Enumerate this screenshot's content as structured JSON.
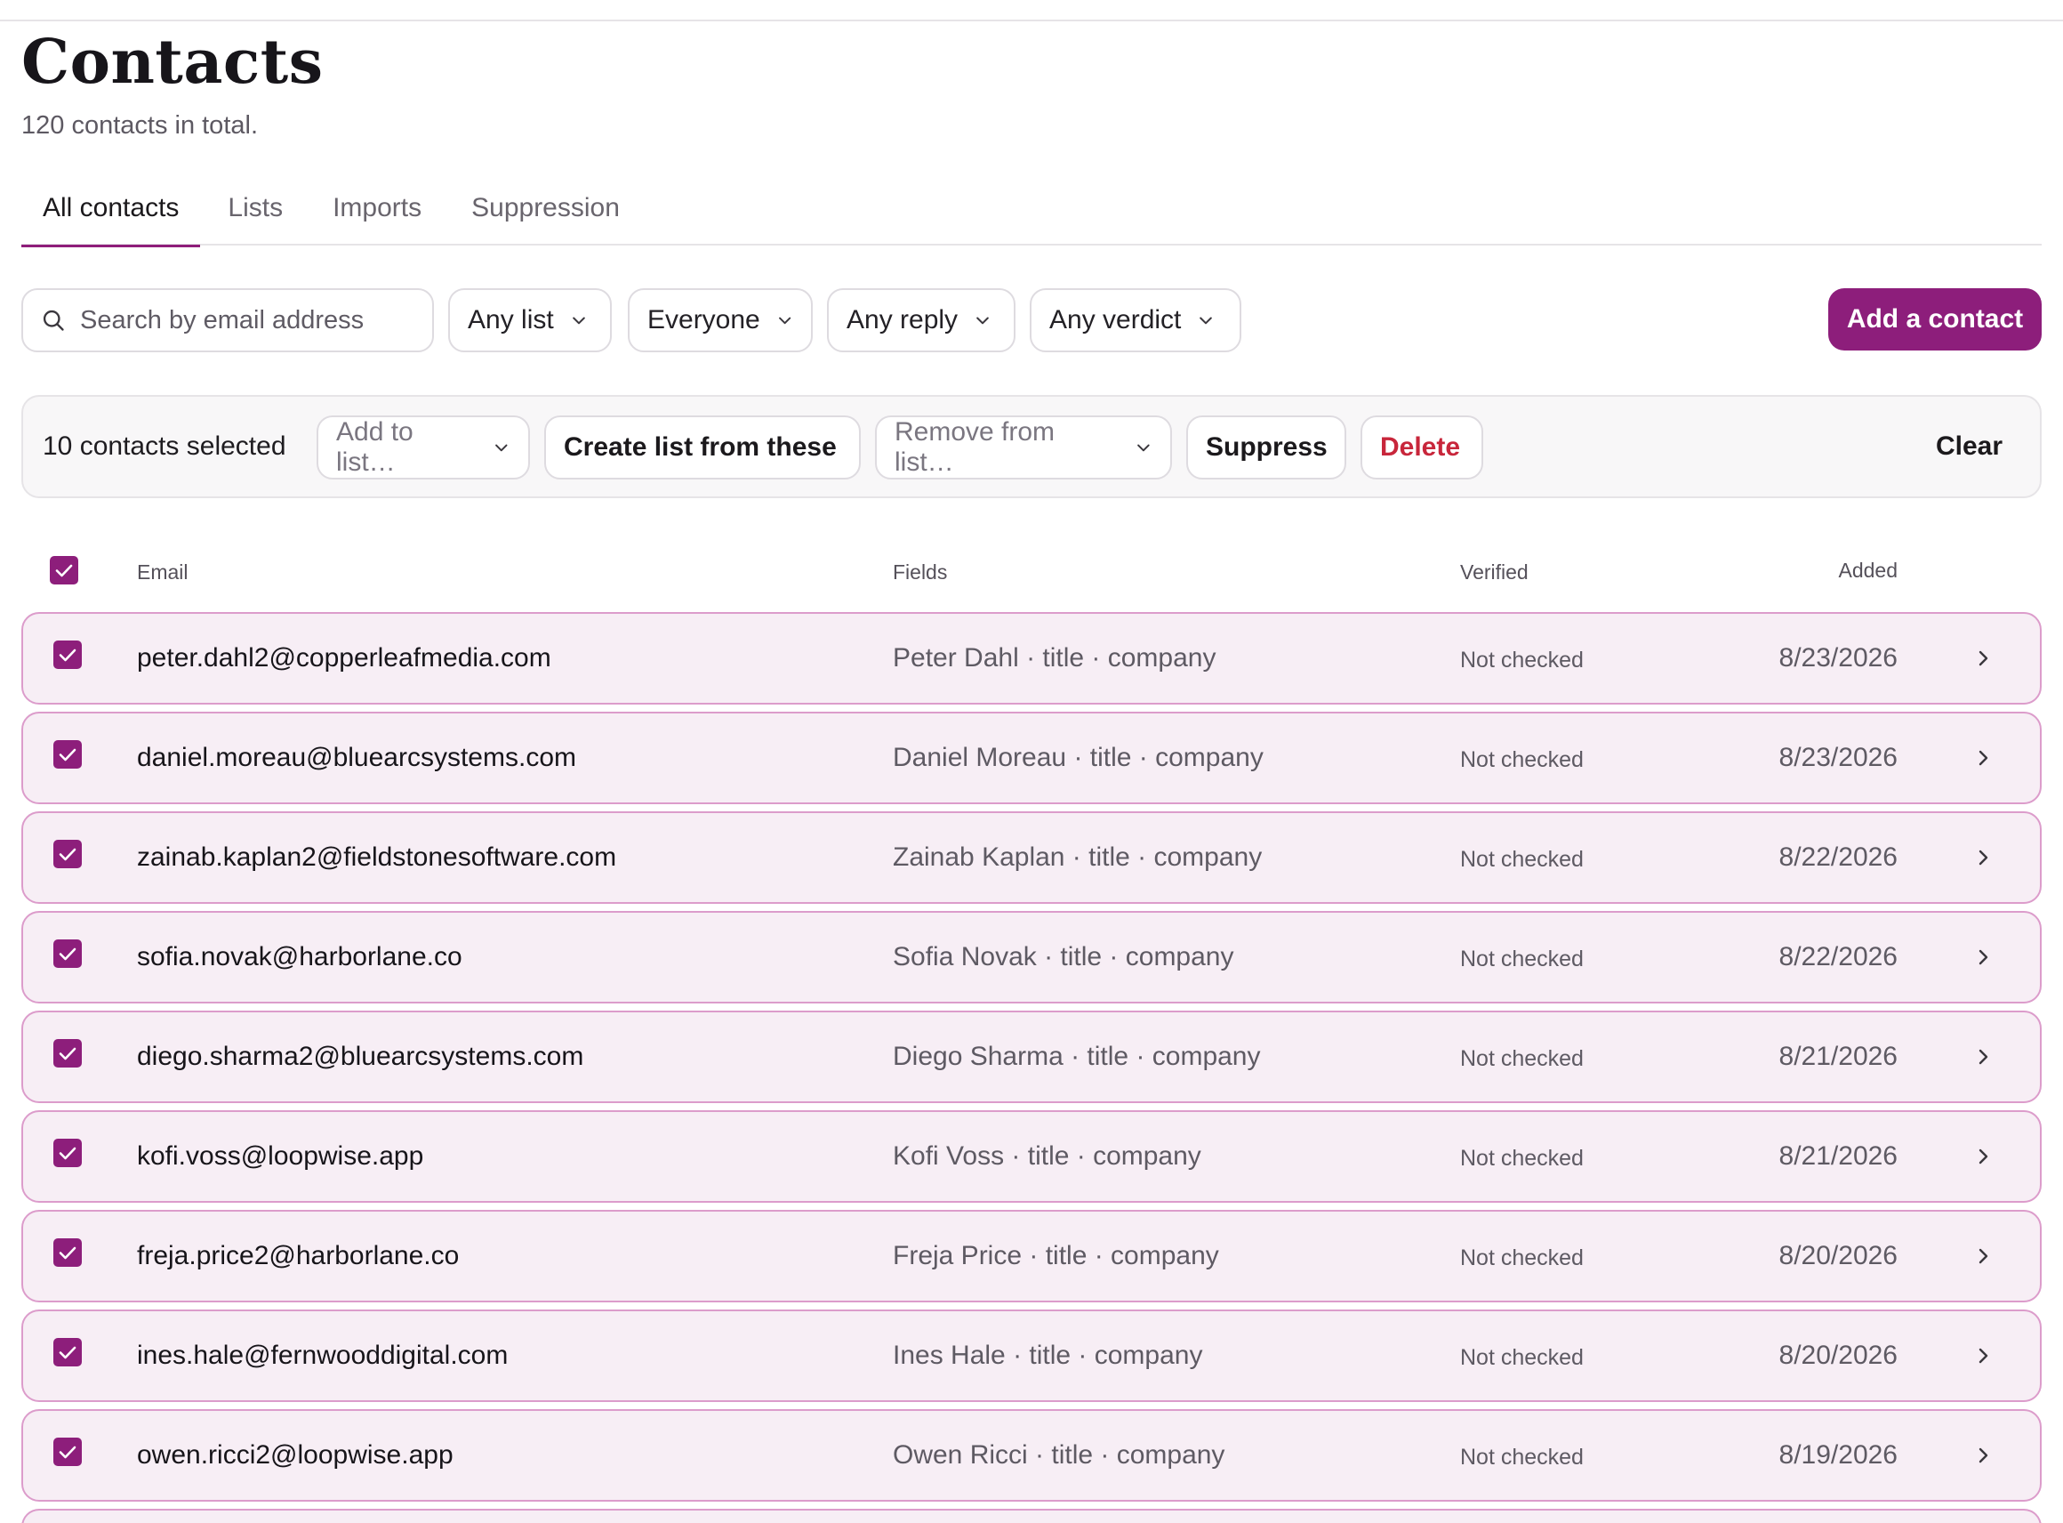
{
  "page": {
    "title": "Contacts",
    "subtitle": "120 contacts in total."
  },
  "tabs": [
    {
      "label": "All contacts",
      "active": true
    },
    {
      "label": "Lists",
      "active": false
    },
    {
      "label": "Imports",
      "active": false
    },
    {
      "label": "Suppression",
      "active": false
    }
  ],
  "filters": {
    "search_placeholder": "Search by email address",
    "list": "Any list",
    "audience": "Everyone",
    "reply": "Any reply",
    "verdict": "Any verdict"
  },
  "actions": {
    "add_contact": "Add a contact"
  },
  "selection": {
    "count_label": "10 contacts selected",
    "add_to_list": "Add to list…",
    "create_list": "Create list from these",
    "remove_from_list": "Remove from list…",
    "suppress": "Suppress",
    "delete": "Delete",
    "clear": "Clear"
  },
  "table": {
    "columns": {
      "email": "Email",
      "fields": "Fields",
      "verified": "Verified",
      "added": "Added"
    },
    "rows": [
      {
        "email": "peter.dahl2@copperleafmedia.com",
        "fields": "Peter Dahl · title · company",
        "verified": "Not checked",
        "added": "8/23/2026"
      },
      {
        "email": "daniel.moreau@bluearcsystems.com",
        "fields": "Daniel Moreau · title · company",
        "verified": "Not checked",
        "added": "8/23/2026"
      },
      {
        "email": "zainab.kaplan2@fieldstonesoftware.com",
        "fields": "Zainab Kaplan · title · company",
        "verified": "Not checked",
        "added": "8/22/2026"
      },
      {
        "email": "sofia.novak@harborlane.co",
        "fields": "Sofia Novak · title · company",
        "verified": "Not checked",
        "added": "8/22/2026"
      },
      {
        "email": "diego.sharma2@bluearcsystems.com",
        "fields": "Diego Sharma · title · company",
        "verified": "Not checked",
        "added": "8/21/2026"
      },
      {
        "email": "kofi.voss@loopwise.app",
        "fields": "Kofi Voss · title · company",
        "verified": "Not checked",
        "added": "8/21/2026"
      },
      {
        "email": "freja.price2@harborlane.co",
        "fields": "Freja Price · title · company",
        "verified": "Not checked",
        "added": "8/20/2026"
      },
      {
        "email": "ines.hale@fernwooddigital.com",
        "fields": "Ines Hale · title · company",
        "verified": "Not checked",
        "added": "8/20/2026"
      },
      {
        "email": "owen.ricci2@loopwise.app",
        "fields": "Owen Ricci · title · company",
        "verified": "Not checked",
        "added": "8/19/2026"
      }
    ]
  },
  "icons": {
    "search": "search-icon",
    "dropdown": "chevron-down-icon",
    "row_open": "chevron-right-icon",
    "checked": "checkbox-checked-icon"
  },
  "colors": {
    "accent": "#8d1e7b",
    "row_bg": "#f7eef5",
    "row_border": "#dc9ccb",
    "danger": "#c8263b"
  }
}
